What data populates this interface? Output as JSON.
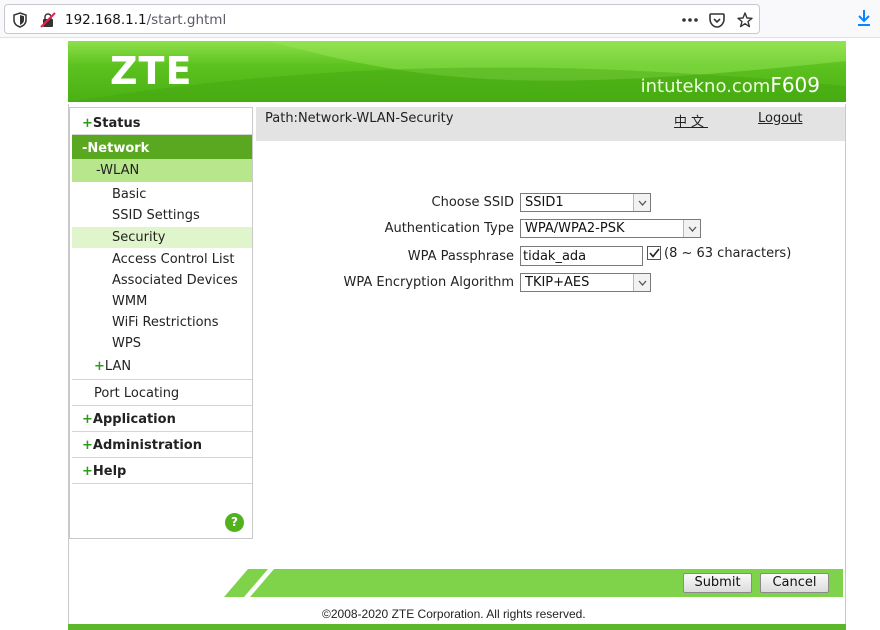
{
  "browser": {
    "url_host": "192.168.1.1",
    "url_path": "/start.ghtml"
  },
  "header": {
    "logo": "ZTE",
    "brand_site": "intutekno.com",
    "model": "F609"
  },
  "sidebar": {
    "status": "Status",
    "network": "Network",
    "wlan": "WLAN",
    "wlan_items": [
      "Basic",
      "SSID Settings",
      "Security",
      "Access Control List",
      "Associated Devices",
      "WMM",
      "WiFi Restrictions",
      "WPS"
    ],
    "lan": "LAN",
    "port_locating": "Port Locating",
    "application": "Application",
    "administration": "Administration",
    "help": "Help",
    "help_icon": "?",
    "plus": "+",
    "minus": "-"
  },
  "main": {
    "path": "Path:Network-WLAN-Security",
    "lang": "中文",
    "logout": "Logout",
    "fields": {
      "ssid_label": "Choose SSID",
      "ssid_value": "SSID1",
      "auth_label": "Authentication Type",
      "auth_value": "WPA/WPA2-PSK",
      "pass_label": "WPA Passphrase",
      "pass_value": "tidak_ada",
      "pass_hint": "(8 ~ 63 characters)",
      "enc_label": "WPA Encryption Algorithm",
      "enc_value": "TKIP+AES"
    }
  },
  "footer": {
    "submit": "Submit",
    "cancel": "Cancel",
    "copyright": "©2008-2020 ZTE Corporation. All rights reserved."
  },
  "colors": {
    "accent_green": "#5aa81f",
    "light_green": "#b8e68d"
  }
}
